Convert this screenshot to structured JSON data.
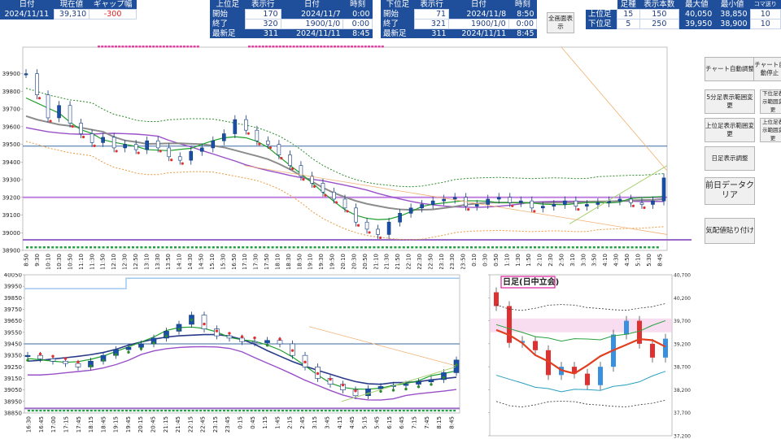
{
  "header_left": {
    "date_label": "日付",
    "price_label": "現在値",
    "gap_label": "ギャップ幅",
    "date": "2024/11/11",
    "price": "39,310",
    "gap": "-300"
  },
  "header_upper": {
    "label_col": "上位足",
    "start": "開始",
    "end": "終了",
    "latest": "最新足",
    "row_col": "表示行",
    "rows": [
      "170",
      "320",
      "311"
    ],
    "date_col": "日付",
    "dates": [
      "2024/11/7",
      "1900/1/0",
      "2024/11/11"
    ],
    "time_col": "時刻",
    "times": [
      "0:00",
      "0:00",
      "8:45"
    ]
  },
  "header_lower": {
    "label_col": "下位足",
    "start": "開始",
    "end": "終了",
    "latest": "最新足",
    "row_col": "表示行",
    "rows": [
      "71",
      "321",
      "311"
    ],
    "date_col": "日付",
    "dates": [
      "2024/11/8",
      "1900/1/0",
      "2024/11/11"
    ],
    "time_col": "時刻",
    "times": [
      "8:50",
      "0:00",
      "8:45"
    ]
  },
  "full_screen_button": "全画面表示",
  "header_right": {
    "col_bars": "足種",
    "col_count": "表示本数",
    "col_max": "最大値",
    "col_min": "最小値",
    "col_comma": "コマ送り",
    "rows": [
      {
        "label": "上位足",
        "bars": "15",
        "count": "150",
        "max": "40,050",
        "min": "38,850",
        "comma": "10"
      },
      {
        "label": "下位足",
        "bars": "5",
        "count": "250",
        "max": "39,950",
        "min": "38,900",
        "comma": "10"
      }
    ]
  },
  "side_buttons": {
    "auto_adjust": "チャート自動調整",
    "auto_stop": "チャート自動停止",
    "range_5min": "5分足表示範囲変更",
    "lower_range": "下位足表示範囲変更",
    "upper_range": "上位足表示範囲変更",
    "upper_range2": "上位足表示範囲変更",
    "daily_adjust": "日足表示調整",
    "clear_prev": "前日データクリア",
    "paste_prices": "気配値貼り付け"
  },
  "chart_data": [
    {
      "type": "line",
      "title": "",
      "x_ticks": [
        "8:50",
        "9:30",
        "10:10",
        "10:30",
        "10:50",
        "11:10",
        "11:30",
        "11:50",
        "12:10",
        "12:30",
        "12:50",
        "13:10",
        "13:30",
        "13:50",
        "14:10",
        "14:30",
        "14:50",
        "15:10",
        "15:30",
        "16:50",
        "17:10",
        "17:30",
        "17:50",
        "18:10",
        "18:30",
        "18:50",
        "19:10",
        "19:30",
        "19:50",
        "20:10",
        "20:30",
        "20:50",
        "21:10",
        "21:30",
        "21:50",
        "22:10",
        "22:30",
        "22:50",
        "23:10",
        "23:30",
        "23:50",
        "0:10",
        "0:30",
        "0:50",
        "1:10",
        "1:30",
        "1:50",
        "2:10",
        "2:30",
        "2:50",
        "3:10",
        "3:30",
        "3:50",
        "4:10",
        "4:30",
        "4:50",
        "5:10",
        "5:30",
        "8:45"
      ],
      "y_ticks": [
        38900,
        39000,
        39100,
        39200,
        39300,
        39400,
        39500,
        39600,
        39700,
        39800,
        39900
      ],
      "ylim": [
        38900,
        40050
      ],
      "price_series": [
        39900,
        39780,
        39650,
        39720,
        39620,
        39560,
        39510,
        39540,
        39480,
        39500,
        39470,
        39520,
        39480,
        39430,
        39410,
        39460,
        39480,
        39520,
        39560,
        39640,
        39580,
        39520,
        39500,
        39440,
        39380,
        39320,
        39280,
        39230,
        39190,
        39140,
        39060,
        39020,
        38990,
        39060,
        39110,
        39140,
        39160,
        39180,
        39190,
        39200,
        39150,
        39160,
        39190,
        39200,
        39170,
        39180,
        39140,
        39150,
        39160,
        39180,
        39150,
        39160,
        39170,
        39180,
        39190,
        39170,
        39160,
        39180,
        39310
      ]
    },
    {
      "type": "line",
      "title": "",
      "x_ticks": [
        "16:30",
        "16:45",
        "17:00",
        "17:15",
        "17:45",
        "18:15",
        "18:45",
        "19:15",
        "19:45",
        "20:15",
        "20:45",
        "21:15",
        "21:45",
        "22:15",
        "22:45",
        "23:15",
        "23:45",
        "0:15",
        "0:45",
        "1:15",
        "1:45",
        "2:15",
        "2:45",
        "3:15",
        "3:45",
        "4:15",
        "4:45",
        "5:15",
        "5:45",
        "6:15",
        "6:45",
        "7:15",
        "7:45",
        "8:15",
        "8:45"
      ],
      "y_ticks": [
        38850,
        38950,
        39050,
        39150,
        39250,
        39350,
        39450,
        39550,
        39650,
        39750,
        39850,
        39950,
        40050
      ],
      "ylim": [
        38850,
        40050
      ],
      "price_series": [
        39350,
        39320,
        39300,
        39280,
        39250,
        39300,
        39350,
        39400,
        39420,
        39450,
        39500,
        39560,
        39620,
        39700,
        39580,
        39520,
        39500,
        39470,
        39460,
        39480,
        39450,
        39350,
        39250,
        39150,
        39100,
        39050,
        39000,
        39060,
        39080,
        39090,
        39100,
        39120,
        39140,
        39200,
        39310
      ]
    },
    {
      "type": "line",
      "title": "日足(日中立会)",
      "y_ticks": [
        37200,
        37700,
        38200,
        38700,
        39200,
        39700,
        40200,
        40700
      ],
      "ylim": [
        37200,
        40700
      ],
      "close_series": [
        40020,
        39220,
        39260,
        39060,
        38520,
        38700,
        38550,
        38300,
        38700,
        39400,
        39700,
        39200,
        38900,
        39310
      ]
    }
  ],
  "colors": {
    "header_bg": "#1f4e9a",
    "candle_up": "#1a4fa8",
    "candle_down": "#e03030",
    "ma_green": "#1fa02a",
    "ma_purple": "#9950c8",
    "ma_gray": "#8c8c8c",
    "ma_orange": "#e89a40"
  }
}
